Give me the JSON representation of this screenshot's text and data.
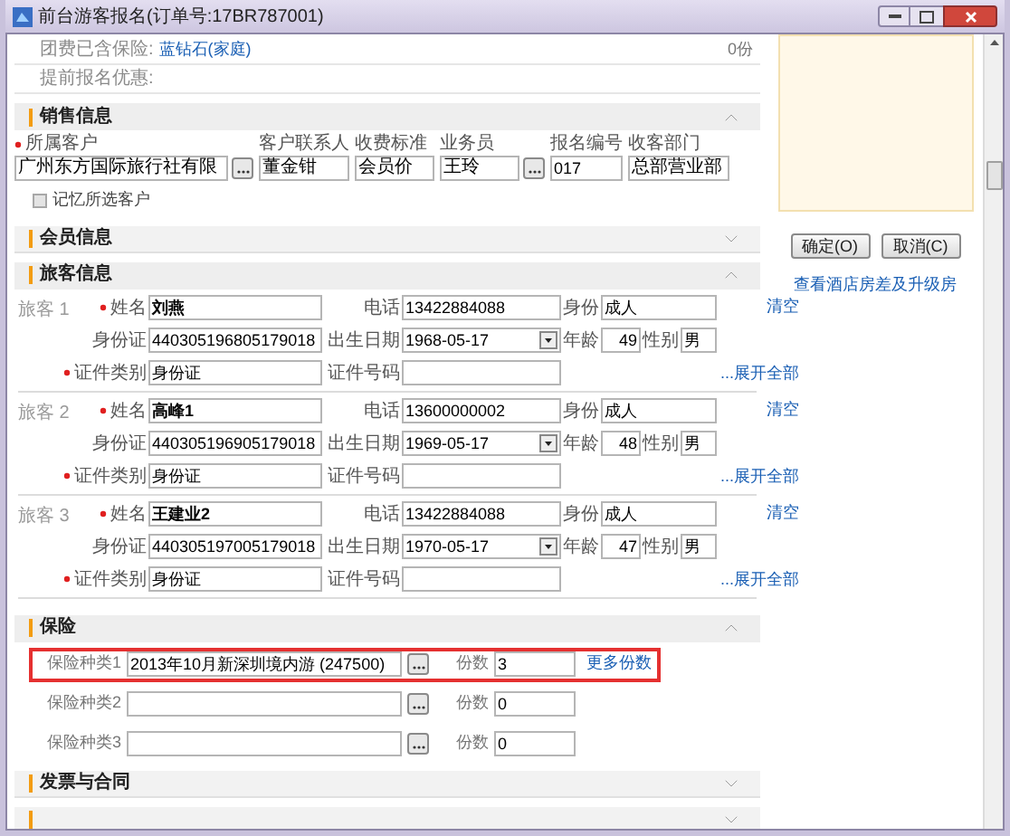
{
  "window": {
    "title": "前台游客报名(订单号:17BR787001)"
  },
  "top_info": [
    {
      "label": "团费已含保险:",
      "value": "蓝钻石(家庭)",
      "count": "0份"
    },
    {
      "label": "提前报名优惠:"
    }
  ],
  "sales": {
    "title": "销售信息",
    "expanded": true,
    "fields": [
      {
        "label": "所属客户",
        "value": "广州东方国际旅行社有限",
        "required": true,
        "kind": "picker"
      },
      {
        "label": "客户联系人",
        "value": "董金钳",
        "required": false,
        "kind": "text"
      },
      {
        "label": "收费标准",
        "value": "会员价",
        "required": false,
        "kind": "text"
      },
      {
        "label": "业务员",
        "value": "王玲",
        "required": false,
        "kind": "picker"
      },
      {
        "label": "报名编号",
        "value": "017",
        "required": false,
        "kind": "text"
      },
      {
        "label": "收客部门",
        "value": "总部营业部",
        "required": false,
        "kind": "text"
      }
    ],
    "remember": {
      "label": "记忆所选客户",
      "checked": false
    }
  },
  "member": {
    "title": "会员信息",
    "expanded": false
  },
  "passengers": {
    "title": "旅客信息",
    "expanded": true,
    "items": [
      {
        "label": "旅客 1",
        "clear": "清空",
        "expand": "...展开全部",
        "rows": [
          [
            {
              "label": "姓名",
              "value": "刘燕",
              "required": true,
              "kind": "name"
            },
            {
              "label": "电话",
              "value": "13422884088",
              "required": false,
              "kind": "text"
            },
            {
              "label": "身份",
              "value": "成人",
              "required": false,
              "kind": "short"
            }
          ],
          [
            {
              "label": "身份证",
              "value": "440305196805179018",
              "required": false,
              "kind": "text"
            },
            {
              "label": "出生日期",
              "value": "1968-05-17",
              "required": false,
              "kind": "date"
            },
            {
              "label": "年龄",
              "value": "49",
              "required": false,
              "kind": "number"
            },
            {
              "label": "性别",
              "value": "男",
              "required": false,
              "kind": "tiny"
            }
          ],
          [
            {
              "label": "证件类别",
              "value": "身份证",
              "required": true,
              "kind": "text"
            },
            {
              "label": "证件号码",
              "required": false,
              "kind": "text"
            }
          ]
        ]
      },
      {
        "label": "旅客 2",
        "clear": "清空",
        "expand": "...展开全部",
        "rows": [
          [
            {
              "label": "姓名",
              "value": "高峰1",
              "required": true,
              "kind": "name"
            },
            {
              "label": "电话",
              "value": "13600000002",
              "required": false,
              "kind": "text"
            },
            {
              "label": "身份",
              "value": "成人",
              "required": false,
              "kind": "short"
            }
          ],
          [
            {
              "label": "身份证",
              "value": "440305196905179018",
              "required": false,
              "kind": "text"
            },
            {
              "label": "出生日期",
              "value": "1969-05-17",
              "required": false,
              "kind": "date"
            },
            {
              "label": "年龄",
              "value": "48",
              "required": false,
              "kind": "number"
            },
            {
              "label": "性别",
              "value": "男",
              "required": false,
              "kind": "tiny"
            }
          ],
          [
            {
              "label": "证件类别",
              "value": "身份证",
              "required": true,
              "kind": "text"
            },
            {
              "label": "证件号码",
              "required": false,
              "kind": "text"
            }
          ]
        ]
      },
      {
        "label": "旅客 3",
        "clear": "清空",
        "expand": "...展开全部",
        "rows": [
          [
            {
              "label": "姓名",
              "value": "王建业2",
              "required": true,
              "kind": "name"
            },
            {
              "label": "电话",
              "value": "13422884088",
              "required": false,
              "kind": "text"
            },
            {
              "label": "身份",
              "value": "成人",
              "required": false,
              "kind": "short"
            }
          ],
          [
            {
              "label": "身份证",
              "value": "440305197005179018",
              "required": false,
              "kind": "text"
            },
            {
              "label": "出生日期",
              "value": "1970-05-17",
              "required": false,
              "kind": "date"
            },
            {
              "label": "年龄",
              "value": "47",
              "required": false,
              "kind": "number"
            },
            {
              "label": "性别",
              "value": "男",
              "required": false,
              "kind": "tiny"
            }
          ],
          [
            {
              "label": "证件类别",
              "value": "身份证",
              "required": true,
              "kind": "text"
            },
            {
              "label": "证件号码",
              "required": false,
              "kind": "text"
            }
          ]
        ]
      }
    ]
  },
  "insurance": {
    "title": "保险",
    "expanded": true,
    "rows": [
      {
        "label": "保险种类1",
        "value": "2013年10月新深圳境内游 (247500)",
        "qty_label": "份数",
        "qty": "3",
        "more": "更多份数",
        "highlighted": true
      },
      {
        "label": "保险种类2",
        "qty_label": "份数",
        "qty": "0",
        "highlighted": false
      },
      {
        "label": "保险种类3",
        "qty_label": "份数",
        "qty": "0",
        "highlighted": false
      }
    ]
  },
  "more_sections": [
    {
      "title": "发票与合同",
      "expanded": false
    },
    {
      "expanded": false
    }
  ],
  "side": {
    "buttons": [
      "确定(O)",
      "取消(C)"
    ],
    "link": "查看酒店房差及升级房"
  }
}
